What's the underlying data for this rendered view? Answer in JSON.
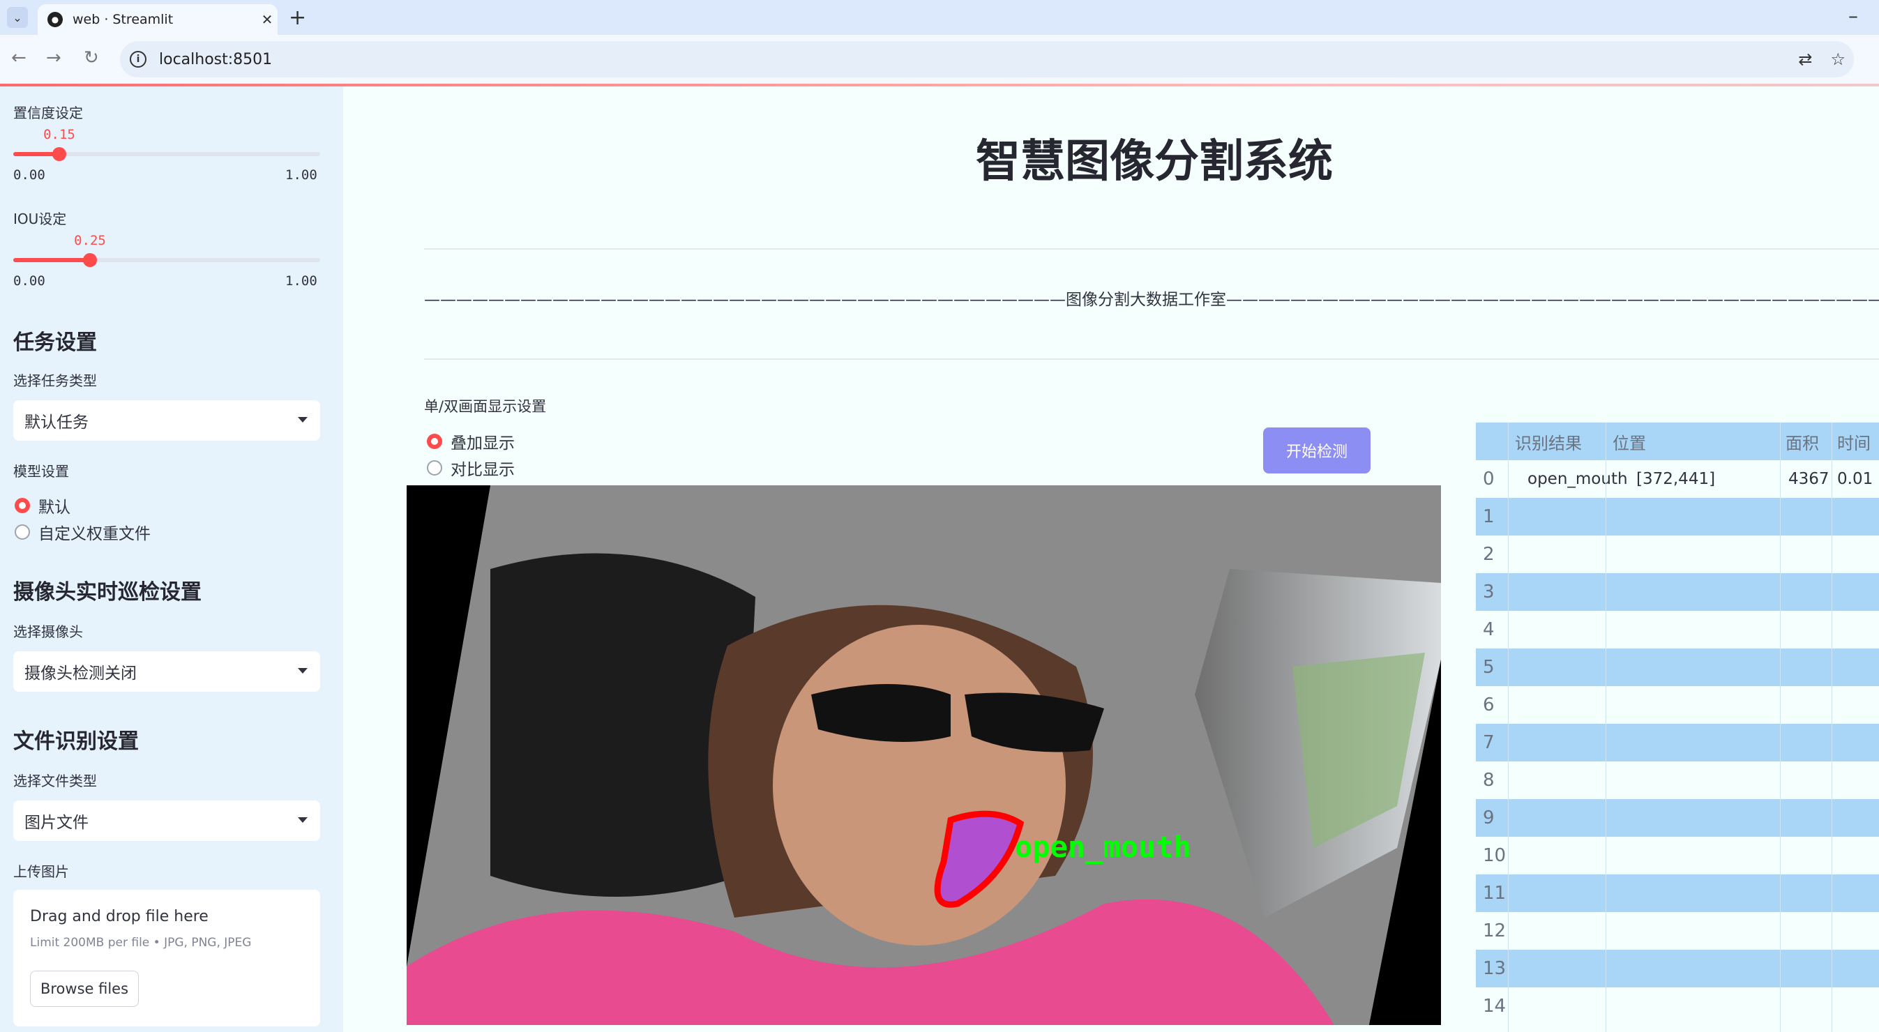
{
  "browser": {
    "tab_title": "web · Streamlit",
    "url": "localhost:8501"
  },
  "sidebar": {
    "confidence": {
      "label": "置信度设定",
      "value": 0.15,
      "value_text": "0.15",
      "min_text": "0.00",
      "max_text": "1.00"
    },
    "iou": {
      "label": "IOU设定",
      "value": 0.25,
      "value_text": "0.25",
      "min_text": "0.00",
      "max_text": "1.00"
    },
    "task_section": "任务设置",
    "task_type_label": "选择任务类型",
    "task_type_value": "默认任务",
    "model_label": "模型设置",
    "model_options": [
      "默认",
      "自定义权重文件"
    ],
    "model_selected": 0,
    "camera_section": "摄像头实时巡检设置",
    "camera_label": "选择摄像头",
    "camera_value": "摄像头检测关闭",
    "file_section": "文件识别设置",
    "file_type_label": "选择文件类型",
    "file_type_value": "图片文件",
    "upload_label": "上传图片",
    "upload_title": "Drag and drop file here",
    "upload_sub": "Limit 200MB per file • JPG, PNG, JPEG",
    "upload_button": "Browse files"
  },
  "main": {
    "title": "智慧图像分割系统",
    "divider_text": "————————————————————————————————————————图像分割大数据工作室—————————————————————————————————————————————",
    "display_label": "单/双画面显示设置",
    "display_options": [
      "叠加显示",
      "对比显示"
    ],
    "display_selected": 0,
    "detect_button": "开始检测",
    "detection_label": "open_mouth"
  },
  "table": {
    "headers": [
      "",
      "识别结果",
      "位置",
      "面积",
      "时间"
    ],
    "rows": [
      {
        "idx": "0",
        "result": "open_mouth",
        "position": "[372,441]",
        "area": "4367",
        "time": "0.01"
      },
      {
        "idx": "1",
        "result": "",
        "position": "",
        "area": "",
        "time": ""
      },
      {
        "idx": "2",
        "result": "",
        "position": "",
        "area": "",
        "time": ""
      },
      {
        "idx": "3",
        "result": "",
        "position": "",
        "area": "",
        "time": ""
      },
      {
        "idx": "4",
        "result": "",
        "position": "",
        "area": "",
        "time": ""
      },
      {
        "idx": "5",
        "result": "",
        "position": "",
        "area": "",
        "time": ""
      },
      {
        "idx": "6",
        "result": "",
        "position": "",
        "area": "",
        "time": ""
      },
      {
        "idx": "7",
        "result": "",
        "position": "",
        "area": "",
        "time": ""
      },
      {
        "idx": "8",
        "result": "",
        "position": "",
        "area": "",
        "time": ""
      },
      {
        "idx": "9",
        "result": "",
        "position": "",
        "area": "",
        "time": ""
      },
      {
        "idx": "10",
        "result": "",
        "position": "",
        "area": "",
        "time": ""
      },
      {
        "idx": "11",
        "result": "",
        "position": "",
        "area": "",
        "time": ""
      },
      {
        "idx": "12",
        "result": "",
        "position": "",
        "area": "",
        "time": ""
      },
      {
        "idx": "13",
        "result": "",
        "position": "",
        "area": "",
        "time": ""
      },
      {
        "idx": "14",
        "result": "",
        "position": "",
        "area": "",
        "time": ""
      }
    ]
  },
  "colors": {
    "accent": "#ff4b4b",
    "button": "#8d8ef3",
    "sidebar_bg": "#e6f3fc",
    "table_stripe": "#a9d6f7",
    "mask": "#b04fd0",
    "mask_outline": "#ff0000",
    "label_text": "#00ff00"
  }
}
